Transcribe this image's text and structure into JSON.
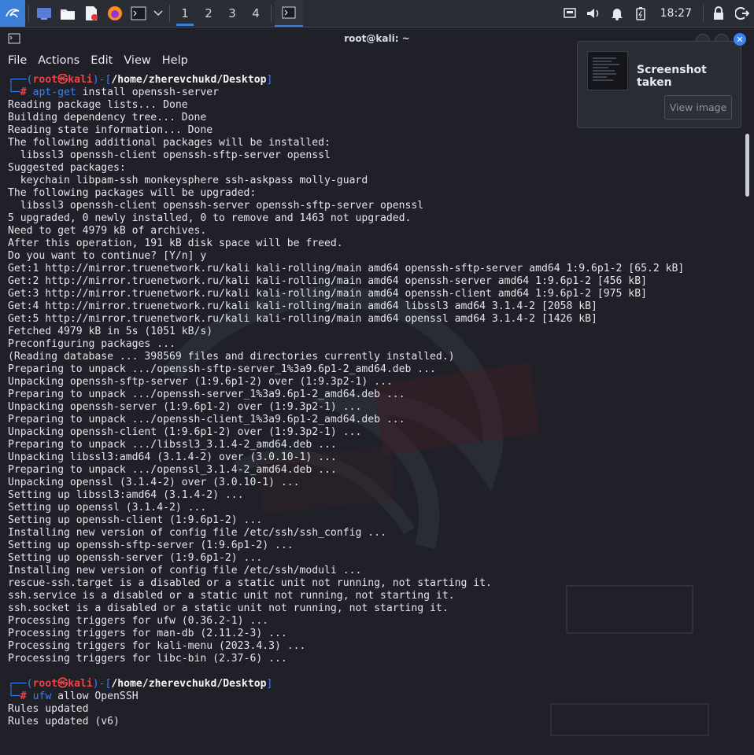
{
  "taskbar": {
    "workspaces": [
      "1",
      "2",
      "3",
      "4"
    ],
    "clock": "18:27",
    "icons": [
      "kali-menu-icon",
      "desktop-icon",
      "file-manager-icon",
      "text-editor-icon",
      "firefox-icon",
      "terminal-icon",
      "chevron-down-icon",
      "terminal-window-icon",
      "display-icon",
      "volume-icon",
      "bell-icon",
      "battery-icon",
      "lock-icon",
      "logout-icon"
    ]
  },
  "window": {
    "title": "root@kali: ~",
    "menu": [
      "File",
      "Actions",
      "Edit",
      "View",
      "Help"
    ]
  },
  "notification": {
    "title": "Screenshot taken",
    "button": "View image"
  },
  "prompt": {
    "user": "root",
    "at": "㉿",
    "host": "kali",
    "path": "/home/zherevchukd/Desktop",
    "symbol": "#"
  },
  "commands": [
    {
      "cmd": "apt-get",
      "args": " install openssh-server"
    },
    {
      "cmd": "ufw",
      "args": " allow OpenSSH"
    }
  ],
  "output1": [
    "Reading package lists... Done",
    "Building dependency tree... Done",
    "Reading state information... Done",
    "The following additional packages will be installed:",
    "  libssl3 openssh-client openssh-sftp-server openssl",
    "Suggested packages:",
    "  keychain libpam-ssh monkeysphere ssh-askpass molly-guard",
    "The following packages will be upgraded:",
    "  libssl3 openssh-client openssh-server openssh-sftp-server openssl",
    "5 upgraded, 0 newly installed, 0 to remove and 1463 not upgraded.",
    "Need to get 4979 kB of archives.",
    "After this operation, 191 kB disk space will be freed.",
    "Do you want to continue? [Y/n] y",
    "Get:1 http://mirror.truenetwork.ru/kali kali-rolling/main amd64 openssh-sftp-server amd64 1:9.6p1-2 [65.2 kB]",
    "Get:2 http://mirror.truenetwork.ru/kali kali-rolling/main amd64 openssh-server amd64 1:9.6p1-2 [456 kB]",
    "Get:3 http://mirror.truenetwork.ru/kali kali-rolling/main amd64 openssh-client amd64 1:9.6p1-2 [975 kB]",
    "Get:4 http://mirror.truenetwork.ru/kali kali-rolling/main amd64 libssl3 amd64 3.1.4-2 [2058 kB]",
    "Get:5 http://mirror.truenetwork.ru/kali kali-rolling/main amd64 openssl amd64 3.1.4-2 [1426 kB]",
    "Fetched 4979 kB in 5s (1051 kB/s)",
    "Preconfiguring packages ...",
    "(Reading database ... 398569 files and directories currently installed.)",
    "Preparing to unpack .../openssh-sftp-server_1%3a9.6p1-2_amd64.deb ...",
    "Unpacking openssh-sftp-server (1:9.6p1-2) over (1:9.3p2-1) ...",
    "Preparing to unpack .../openssh-server_1%3a9.6p1-2_amd64.deb ...",
    "Unpacking openssh-server (1:9.6p1-2) over (1:9.3p2-1) ...",
    "Preparing to unpack .../openssh-client_1%3a9.6p1-2_amd64.deb ...",
    "Unpacking openssh-client (1:9.6p1-2) over (1:9.3p2-1) ...",
    "Preparing to unpack .../libssl3_3.1.4-2_amd64.deb ...",
    "Unpacking libssl3:amd64 (3.1.4-2) over (3.0.10-1) ...",
    "Preparing to unpack .../openssl_3.1.4-2_amd64.deb ...",
    "Unpacking openssl (3.1.4-2) over (3.0.10-1) ...",
    "Setting up libssl3:amd64 (3.1.4-2) ...",
    "Setting up openssl (3.1.4-2) ...",
    "Setting up openssh-client (1:9.6p1-2) ...",
    "Installing new version of config file /etc/ssh/ssh_config ...",
    "Setting up openssh-sftp-server (1:9.6p1-2) ...",
    "Setting up openssh-server (1:9.6p1-2) ...",
    "Installing new version of config file /etc/ssh/moduli ...",
    "rescue-ssh.target is a disabled or a static unit not running, not starting it.",
    "ssh.service is a disabled or a static unit not running, not starting it.",
    "ssh.socket is a disabled or a static unit not running, not starting it.",
    "Processing triggers for ufw (0.36.2-1) ...",
    "Processing triggers for man-db (2.11.2-3) ...",
    "Processing triggers for kali-menu (2023.4.3) ...",
    "Processing triggers for libc-bin (2.37-6) ...",
    ""
  ],
  "output2": [
    "Rules updated",
    "Rules updated (v6)"
  ]
}
